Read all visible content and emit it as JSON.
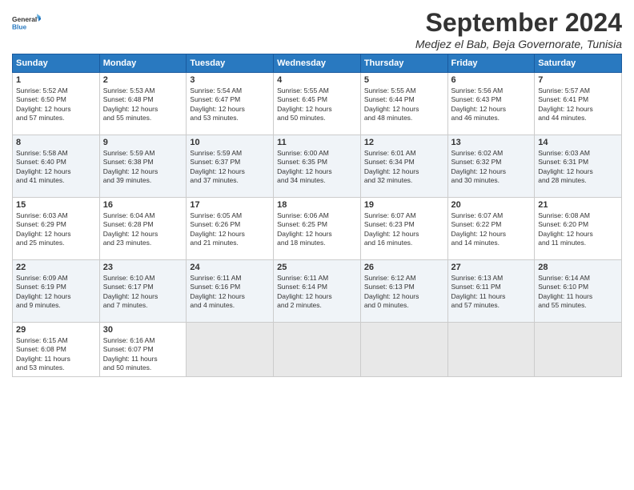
{
  "logo": {
    "general": "General",
    "blue": "Blue"
  },
  "title": "September 2024",
  "subtitle": "Medjez el Bab, Beja Governorate, Tunisia",
  "headers": [
    "Sunday",
    "Monday",
    "Tuesday",
    "Wednesday",
    "Thursday",
    "Friday",
    "Saturday"
  ],
  "weeks": [
    [
      {
        "day": "1",
        "info": "Sunrise: 5:52 AM\nSunset: 6:50 PM\nDaylight: 12 hours\nand 57 minutes."
      },
      {
        "day": "2",
        "info": "Sunrise: 5:53 AM\nSunset: 6:48 PM\nDaylight: 12 hours\nand 55 minutes."
      },
      {
        "day": "3",
        "info": "Sunrise: 5:54 AM\nSunset: 6:47 PM\nDaylight: 12 hours\nand 53 minutes."
      },
      {
        "day": "4",
        "info": "Sunrise: 5:55 AM\nSunset: 6:45 PM\nDaylight: 12 hours\nand 50 minutes."
      },
      {
        "day": "5",
        "info": "Sunrise: 5:55 AM\nSunset: 6:44 PM\nDaylight: 12 hours\nand 48 minutes."
      },
      {
        "day": "6",
        "info": "Sunrise: 5:56 AM\nSunset: 6:43 PM\nDaylight: 12 hours\nand 46 minutes."
      },
      {
        "day": "7",
        "info": "Sunrise: 5:57 AM\nSunset: 6:41 PM\nDaylight: 12 hours\nand 44 minutes."
      }
    ],
    [
      {
        "day": "8",
        "info": "Sunrise: 5:58 AM\nSunset: 6:40 PM\nDaylight: 12 hours\nand 41 minutes."
      },
      {
        "day": "9",
        "info": "Sunrise: 5:59 AM\nSunset: 6:38 PM\nDaylight: 12 hours\nand 39 minutes."
      },
      {
        "day": "10",
        "info": "Sunrise: 5:59 AM\nSunset: 6:37 PM\nDaylight: 12 hours\nand 37 minutes."
      },
      {
        "day": "11",
        "info": "Sunrise: 6:00 AM\nSunset: 6:35 PM\nDaylight: 12 hours\nand 34 minutes."
      },
      {
        "day": "12",
        "info": "Sunrise: 6:01 AM\nSunset: 6:34 PM\nDaylight: 12 hours\nand 32 minutes."
      },
      {
        "day": "13",
        "info": "Sunrise: 6:02 AM\nSunset: 6:32 PM\nDaylight: 12 hours\nand 30 minutes."
      },
      {
        "day": "14",
        "info": "Sunrise: 6:03 AM\nSunset: 6:31 PM\nDaylight: 12 hours\nand 28 minutes."
      }
    ],
    [
      {
        "day": "15",
        "info": "Sunrise: 6:03 AM\nSunset: 6:29 PM\nDaylight: 12 hours\nand 25 minutes."
      },
      {
        "day": "16",
        "info": "Sunrise: 6:04 AM\nSunset: 6:28 PM\nDaylight: 12 hours\nand 23 minutes."
      },
      {
        "day": "17",
        "info": "Sunrise: 6:05 AM\nSunset: 6:26 PM\nDaylight: 12 hours\nand 21 minutes."
      },
      {
        "day": "18",
        "info": "Sunrise: 6:06 AM\nSunset: 6:25 PM\nDaylight: 12 hours\nand 18 minutes."
      },
      {
        "day": "19",
        "info": "Sunrise: 6:07 AM\nSunset: 6:23 PM\nDaylight: 12 hours\nand 16 minutes."
      },
      {
        "day": "20",
        "info": "Sunrise: 6:07 AM\nSunset: 6:22 PM\nDaylight: 12 hours\nand 14 minutes."
      },
      {
        "day": "21",
        "info": "Sunrise: 6:08 AM\nSunset: 6:20 PM\nDaylight: 12 hours\nand 11 minutes."
      }
    ],
    [
      {
        "day": "22",
        "info": "Sunrise: 6:09 AM\nSunset: 6:19 PM\nDaylight: 12 hours\nand 9 minutes."
      },
      {
        "day": "23",
        "info": "Sunrise: 6:10 AM\nSunset: 6:17 PM\nDaylight: 12 hours\nand 7 minutes."
      },
      {
        "day": "24",
        "info": "Sunrise: 6:11 AM\nSunset: 6:16 PM\nDaylight: 12 hours\nand 4 minutes."
      },
      {
        "day": "25",
        "info": "Sunrise: 6:11 AM\nSunset: 6:14 PM\nDaylight: 12 hours\nand 2 minutes."
      },
      {
        "day": "26",
        "info": "Sunrise: 6:12 AM\nSunset: 6:13 PM\nDaylight: 12 hours\nand 0 minutes."
      },
      {
        "day": "27",
        "info": "Sunrise: 6:13 AM\nSunset: 6:11 PM\nDaylight: 11 hours\nand 57 minutes."
      },
      {
        "day": "28",
        "info": "Sunrise: 6:14 AM\nSunset: 6:10 PM\nDaylight: 11 hours\nand 55 minutes."
      }
    ],
    [
      {
        "day": "29",
        "info": "Sunrise: 6:15 AM\nSunset: 6:08 PM\nDaylight: 11 hours\nand 53 minutes."
      },
      {
        "day": "30",
        "info": "Sunrise: 6:16 AM\nSunset: 6:07 PM\nDaylight: 11 hours\nand 50 minutes."
      },
      {
        "day": "",
        "info": ""
      },
      {
        "day": "",
        "info": ""
      },
      {
        "day": "",
        "info": ""
      },
      {
        "day": "",
        "info": ""
      },
      {
        "day": "",
        "info": ""
      }
    ]
  ]
}
